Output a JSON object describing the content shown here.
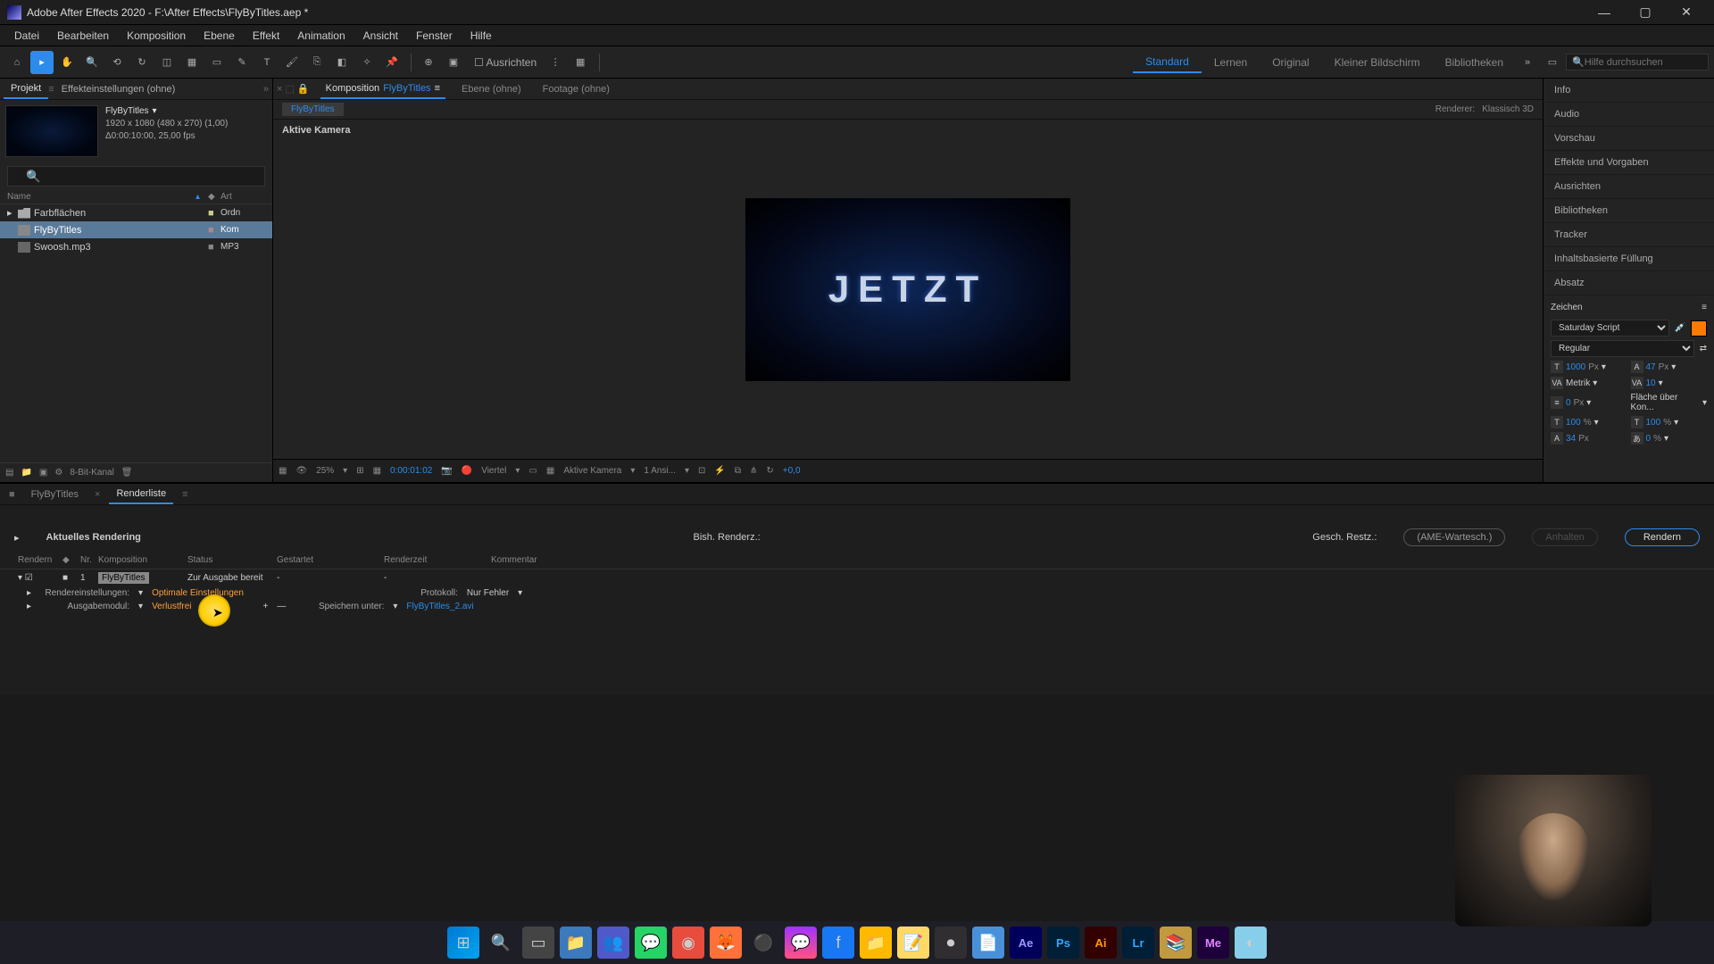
{
  "title_bar": {
    "app": "Adobe After Effects 2020",
    "file": "F:\\After Effects\\FlyByTitles.aep *"
  },
  "menu": [
    "Datei",
    "Bearbeiten",
    "Komposition",
    "Ebene",
    "Effekt",
    "Animation",
    "Ansicht",
    "Fenster",
    "Hilfe"
  ],
  "toolbar": {
    "ausrichten": "Ausrichten",
    "workspaces": [
      "Standard",
      "Lernen",
      "Original",
      "Kleiner Bildschirm",
      "Bibliotheken"
    ],
    "search_placeholder": "Hilfe durchsuchen"
  },
  "project_panel": {
    "tab_project": "Projekt",
    "tab_effects": "Effekteinstellungen (ohne)",
    "comp_name": "FlyByTitles",
    "meta_line1": "1920 x 1080 (480 x 270) (1,00)",
    "meta_line2": "Δ0:00:10:00, 25,00 fps",
    "head_name": "Name",
    "head_art": "Art",
    "items": [
      {
        "name": "Farbflächen",
        "type": "Ordn",
        "icon": "folder"
      },
      {
        "name": "FlyByTitles",
        "type": "Kom",
        "icon": "comp",
        "selected": true
      },
      {
        "name": "Swoosh.mp3",
        "type": "MP3",
        "icon": "audio"
      }
    ]
  },
  "comp_panel": {
    "tabs": {
      "composition": {
        "prefix": "Komposition",
        "name": "FlyByTitles"
      },
      "layer": "Ebene (ohne)",
      "footage": "Footage (ohne)"
    },
    "crumb": "FlyByTitles",
    "renderer_label": "Renderer:",
    "renderer_value": "Klassisch 3D",
    "active_camera": "Aktive Kamera",
    "preview_text": "JETZT"
  },
  "viewer_controls": {
    "zoom": "25%",
    "time": "0:00:01:02",
    "resolution": "Viertel",
    "camera": "Aktive Kamera",
    "views": "1 Ansi...",
    "exposure": "+0,0"
  },
  "right_panel": {
    "items": [
      "Info",
      "Audio",
      "Vorschau",
      "Effekte und Vorgaben",
      "Ausrichten",
      "Bibliotheken",
      "Tracker",
      "Inhaltsbasierte Füllung",
      "Absatz"
    ],
    "character": {
      "title": "Zeichen",
      "font": "Saturday Script",
      "style": "Regular",
      "size": "1000",
      "size_unit": "Px",
      "leading": "47",
      "leading_unit": "Px",
      "kerning": "Metrik",
      "tracking": "10",
      "stroke": "0",
      "stroke_unit": "Px",
      "stroke_type": "Fläche über Kon...",
      "vscale": "100",
      "hscale": "100",
      "scale_unit": "%",
      "baseline": "34",
      "baseline_unit": "Px",
      "tsume": "0",
      "tsume_unit": "%"
    }
  },
  "bottom": {
    "tab_comp": "FlyByTitles",
    "tab_render": "Renderliste",
    "current_render": "Aktuelles Rendering",
    "bish": "Bish. Renderz.:",
    "gesch": "Gesch. Restz.:",
    "btn_ame": "AME-Wartesch.",
    "btn_stop": "Anhalten",
    "btn_render": "Rendern",
    "cols": {
      "render": "Rendern",
      "nr": "Nr.",
      "komp": "Komposition",
      "status": "Status",
      "start": "Gestartet",
      "rz": "Renderzeit",
      "kom": "Kommentar"
    },
    "row": {
      "nr": "1",
      "komp": "FlyByTitles",
      "status": "Zur Ausgabe bereit",
      "start": "-",
      "rz": "-"
    },
    "settings": {
      "render_label": "Rendereinstellungen:",
      "render_val": "Optimale Einstellungen",
      "output_label": "Ausgabemodul:",
      "output_val": "Verlustfrei",
      "protokoll_label": "Protokoll:",
      "protokoll_val": "Nur Fehler",
      "save_label": "Speichern unter:",
      "save_val": "FlyByTitles_2.avi"
    }
  },
  "bottom_toolbar": {
    "bit": "8-Bit-Kanal"
  }
}
